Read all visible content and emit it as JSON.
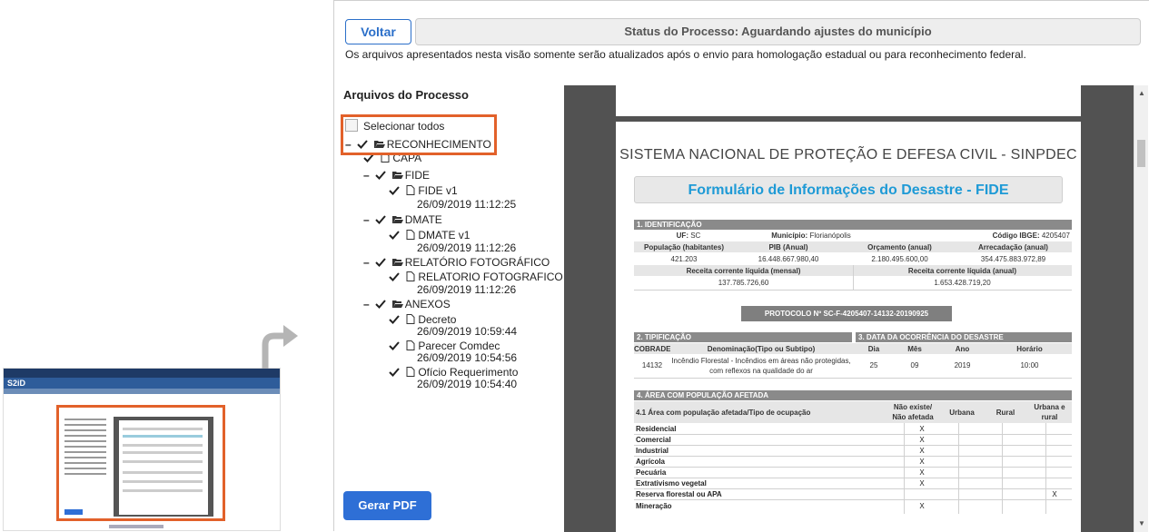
{
  "header": {
    "back_label": "Voltar",
    "status_text": "Status do Processo: Aguardando ajustes do município",
    "notice": "Os arquivos apresentados nesta visão somente serão atualizados após o envio para homologação estadual ou para reconhecimento federal."
  },
  "files": {
    "title": "Arquivos do Processo",
    "select_all": "Selecionar todos",
    "root": "RECONHECIMENTO",
    "capa": "CAPA",
    "fide": "FIDE",
    "fide_file": "FIDE v1",
    "fide_date": "26/09/2019 11:12:25",
    "dmate": "DMATE",
    "dmate_file": "DMATE v1",
    "dmate_date": "26/09/2019 11:12:26",
    "relatorio": "RELATÓRIO FOTOGRÁFICO",
    "relatorio_file": "RELATORIO FOTOGRAFICO v1",
    "relatorio_date": "26/09/2019 11:12:26",
    "anexos": "ANEXOS",
    "decreto": "Decreto",
    "decreto_date": "26/09/2019 10:59:44",
    "parecer": "Parecer Comdec",
    "parecer_date": "26/09/2019 10:54:56",
    "oficio": "Ofício Requerimento",
    "oficio_date": "26/09/2019 10:54:40"
  },
  "pdf_button": "Gerar PDF",
  "document": {
    "system_title": "SISTEMA NACIONAL DE PROTEÇÃO E DEFESA CIVIL - SINPDEC",
    "form_title": "Formulário de Informações do Desastre - FIDE",
    "s1": "1. IDENTIFICAÇÃO",
    "uf_label": "UF:",
    "uf": "SC",
    "mun_label": "Município:",
    "mun": "Florianópolis",
    "ibge_label": "Código IBGE:",
    "ibge": "4205407",
    "pop_label": "População (habitantes)",
    "pop": "421.203",
    "pib_label": "PIB (Anual)",
    "pib": "16.448.667.980,40",
    "orc_label": "Orçamento (anual)",
    "orc": "2.180.495.600,00",
    "arr_label": "Arrecadação (anual)",
    "arr": "354.475.883.972,89",
    "rcl_m_label": "Receita corrente líquida (mensal)",
    "rcl_m": "137.785.726,60",
    "rcl_a_label": "Receita corrente líquida (anual)",
    "rcl_a": "1.653.428.719,20",
    "protocolo": "PROTOCOLO Nº SC-F-4205407-14132-20190925",
    "s2": "2. TIPIFICAÇÃO",
    "cobrade_label": "COBRADE",
    "cobrade": "14132",
    "denom_label": "Denominação(Tipo ou Subtipo)",
    "denom_1": "Incêndio Florestal - Incêndios em áreas não protegidas,",
    "denom_2": "com reflexos na qualidade do ar",
    "s3": "3. DATA DA OCORRÊNCIA DO DESASTRE",
    "dia_label": "Dia",
    "dia": "25",
    "mes_label": "Mês",
    "mes": "09",
    "ano_label": "Ano",
    "ano": "2019",
    "hora_label": "Horário",
    "hora": "10:00",
    "s4": "4. ÁREA COM POPULAÇÃO AFETADA",
    "s41": "4.1 Área com população afetada/Tipo de ocupação",
    "col_nao_1": "Não existe/",
    "col_nao_2": "Não afetada",
    "col_urbana": "Urbana",
    "col_rural": "Rural",
    "col_ur_1": "Urbana e",
    "col_ur_2": "rural",
    "x": "X",
    "rows": [
      "Residencial",
      "Comercial",
      "Industrial",
      "Agrícola",
      "Pecuária",
      "Extrativismo vegetal",
      "Reserva florestal ou APA",
      "Mineração"
    ]
  }
}
